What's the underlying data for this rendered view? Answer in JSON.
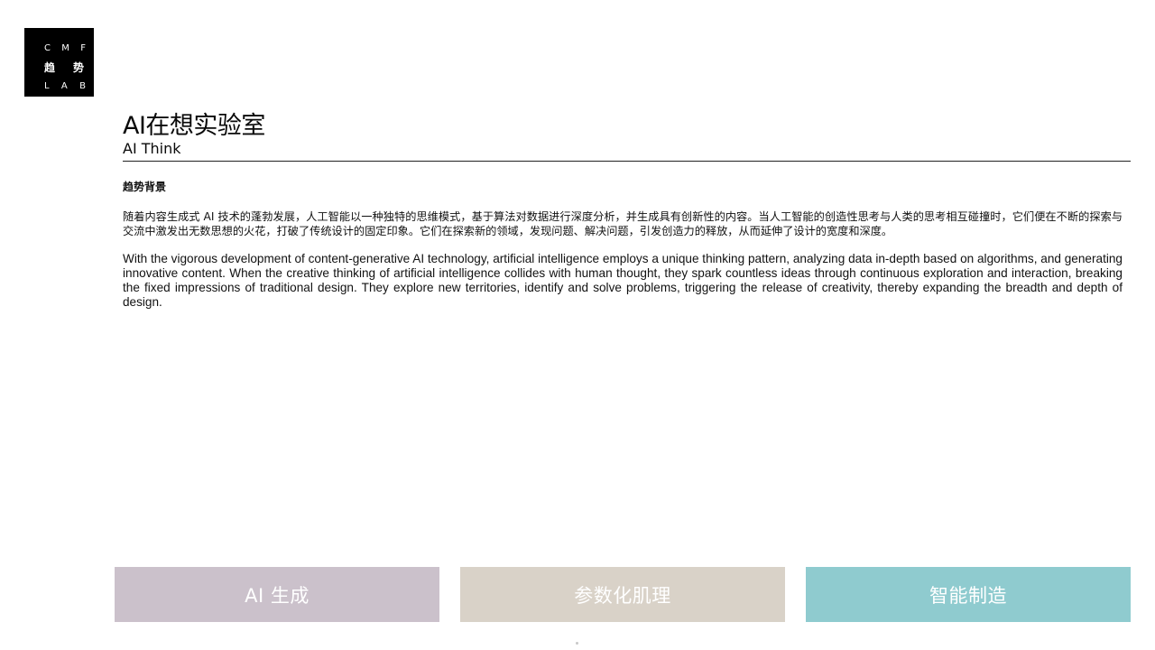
{
  "logo": {
    "line1": [
      "C",
      "M",
      "F"
    ],
    "line2": [
      "趋",
      "势"
    ],
    "line3": [
      "L",
      "A",
      "B"
    ]
  },
  "title": "AI在想实验室",
  "subtitle": "AI Think",
  "section_heading": "趋势背景",
  "paragraph_zh": "随着内容生成式 AI 技术的蓬勃发展，人工智能以一种独特的思维模式，基于算法对数据进行深度分析，并生成具有创新性的内容。当人工智能的创造性思考与人类的思考相互碰撞时，它们便在不断的探索与交流中激发出无数思想的火花，打破了传统设计的固定印象。它们在探索新的领域，发现问题、解决问题，引发创造力的释放，从而延伸了设计的宽度和深度。",
  "paragraph_en": "With the vigorous development of content-generative AI technology, artificial intelligence employs a unique thinking pattern, analyzing data in-depth based on algorithms, and generating innovative content. When the creative thinking of artificial intelligence collides with human thought, they spark countless ideas through continuous exploration and interaction, breaking the fixed impressions of traditional design. They explore new territories, identify and solve problems, triggering the release of creativity, thereby expanding the breadth and depth of design.",
  "tiles": [
    {
      "label": "AI 生成",
      "color": "#cbc1cb"
    },
    {
      "label": "参数化肌理",
      "color": "#d9d2c8"
    },
    {
      "label": "智能制造",
      "color": "#8fcbcf"
    }
  ]
}
